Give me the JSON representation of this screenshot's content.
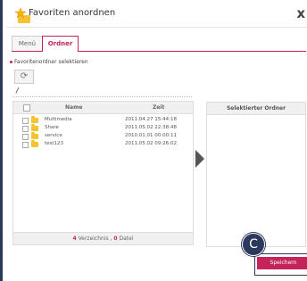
{
  "dialog": {
    "title": "Favoriten anordnen",
    "close_label": "x"
  },
  "tabs": [
    {
      "label": "Menü"
    },
    {
      "label": "Ordner"
    }
  ],
  "section_label": "Favoritenordner selektieren",
  "path": "/",
  "file_table": {
    "col_name": "Name",
    "col_time": "Zeit",
    "rows": [
      {
        "name": "Multimedia",
        "time": "2011.04.27 15:44:18"
      },
      {
        "name": "Share",
        "time": "2011.05.02 22:38:48"
      },
      {
        "name": "service",
        "time": "2010.01.01 00:00:11"
      },
      {
        "name": "test123",
        "time": "2011.05.02 09:26:02"
      }
    ],
    "footer_count": "4",
    "footer_dirs": " Verzeichnis , ",
    "footer_file_count": "0",
    "footer_files": " Datei"
  },
  "selected_panel": {
    "header": "Selektierter Ordner"
  },
  "callout": "C",
  "save_label": "Speichern",
  "colors": {
    "accent": "#c4245a",
    "frame": "#2b3a5c"
  }
}
